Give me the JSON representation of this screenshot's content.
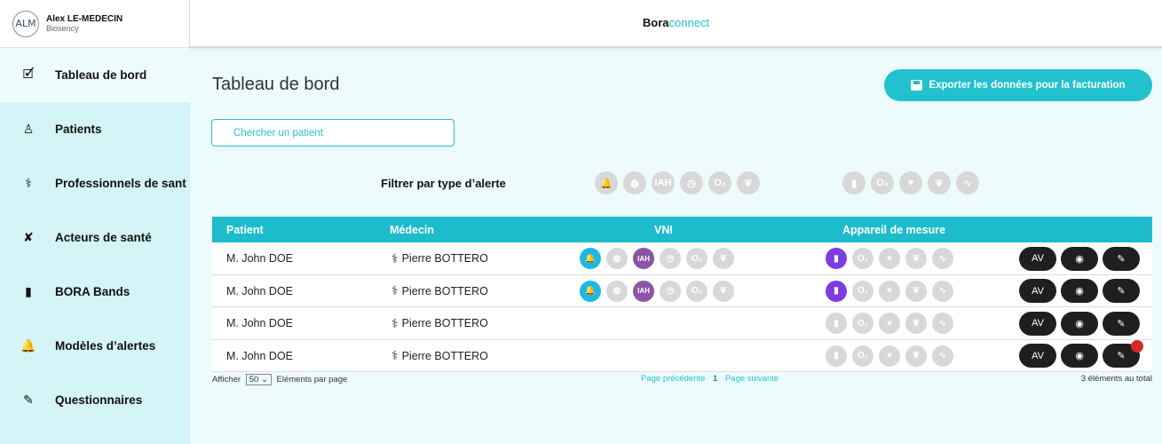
{
  "user": {
    "initials": "ALM",
    "name": "Alex LE-MEDECIN",
    "organization": "Biosency"
  },
  "brand": {
    "part1": "Bora",
    "part2": "connect"
  },
  "sidebar": {
    "items": [
      {
        "label": "Tableau de bord",
        "icon": "calendar-check-icon",
        "active": true
      },
      {
        "label": "Patients",
        "icon": "person-icon",
        "active": false
      },
      {
        "label": "Professionnels de sant",
        "icon": "stethoscope-icon",
        "active": false
      },
      {
        "label": "Acteurs de santé",
        "icon": "tools-icon",
        "active": false
      },
      {
        "label": "BORA Bands",
        "icon": "watch-icon",
        "active": false
      },
      {
        "label": "Modèles d’alertes",
        "icon": "alarm-icon",
        "active": false
      },
      {
        "label": "Questionnaires",
        "icon": "form-edit-icon",
        "active": false
      }
    ]
  },
  "page": {
    "title": "Tableau de bord"
  },
  "export_button": {
    "label": "Exporter les données pour la facturation"
  },
  "search": {
    "placeholder": "Chercher un patient"
  },
  "filter": {
    "label": "Filtrer par type d’alerte",
    "vni_icons": [
      "alarm-icon",
      "mask-icon",
      "IAH",
      "clock-icon",
      "O₂",
      "lungs-icon"
    ],
    "device_icons": [
      "watch-icon",
      "O₂",
      "heart-icon",
      "lungs-icon",
      "pulse-icon"
    ]
  },
  "table": {
    "headers": {
      "patient": "Patient",
      "doctor": "Médecin",
      "vni": "VNI",
      "device": "Appareil de mesure"
    },
    "rows": [
      {
        "patient": "M. John DOE",
        "doctor": "Pierre BOTTERO",
        "vni_active": [
          "alarm",
          "iah"
        ],
        "has_vni": true,
        "device_active": true,
        "notification": false
      },
      {
        "patient": "M. John DOE",
        "doctor": "Pierre BOTTERO",
        "vni_active": [
          "alarm",
          "iah"
        ],
        "has_vni": true,
        "device_active": true,
        "notification": false
      },
      {
        "patient": "M. John DOE",
        "doctor": "Pierre BOTTERO",
        "vni_active": [],
        "has_vni": false,
        "device_active": false,
        "notification": false
      },
      {
        "patient": "M. John DOE",
        "doctor": "Pierre BOTTERO",
        "vni_active": [],
        "has_vni": false,
        "device_active": false,
        "notification": true
      }
    ],
    "actions": {
      "av_label": "AV",
      "view_icon": "eye-icon",
      "edit_icon": "form-edit-icon"
    }
  },
  "footer": {
    "show_label": "Afficher",
    "per_page_value": "50",
    "per_page_label": "Eléments par page",
    "prev_label": "Page précédente",
    "current_page": "1",
    "next_label": "Page suivante",
    "total_label": "3 éléments au total"
  },
  "colors": {
    "accent": "#1dbccb",
    "alert_blue": "#1ab9e6",
    "iah_purple": "#8c55a4",
    "device_violet": "#7d3be0",
    "notification_red": "#d12a2a"
  }
}
